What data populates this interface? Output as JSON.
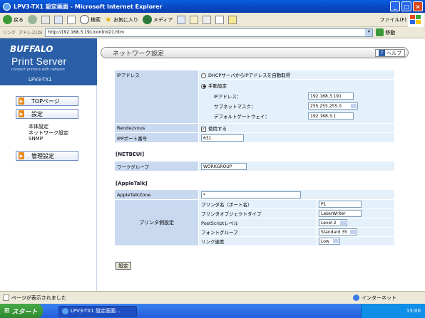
{
  "window": {
    "title": "LPV3-TX1 設定画面 - Microsoft Internet Explorer"
  },
  "toolbar": {
    "back": "戻る",
    "search": "検索",
    "favorites": "お気に入り",
    "media": "メディア",
    "file_menu": "ファイル(F)"
  },
  "address": {
    "link_label": "リンク",
    "label": "アドレス(D)",
    "url": "http://192.168.3.191/control21.htm",
    "go": "移動"
  },
  "sidebar": {
    "logo": "BUFFALO",
    "product": "Print Server",
    "tagline": "connect printers with network",
    "model": "LPV3-TX1",
    "nav": [
      {
        "label": "TOPページ"
      },
      {
        "label": "設定"
      },
      {
        "label": "管理設定"
      }
    ],
    "sub": [
      "本体設定",
      "ネットワーク設定",
      "SNMP"
    ]
  },
  "main": {
    "title": "ネットワーク設定",
    "help": "ヘルプ",
    "ip_label": "IPアドレス",
    "dhcp_option": "DHCPサーバからIPアドレスを自動取得",
    "manual_option": "手動設定",
    "ip_addr_label": "IPアドレス：",
    "ip_addr_value": "192.168.3.191",
    "subnet_label": "サブネットマスク：",
    "subnet_value": "255.255.255.0",
    "gateway_label": "デフォルトゲートウェイ：",
    "gateway_value": "192.168.3.1",
    "rendezvous_label": "Rendezvous",
    "rendezvous_option": "使用する",
    "ipp_label": "IPPポート番号",
    "ipp_value": "631",
    "netbeui_title": "[NETBEUI]",
    "workgroup_label": "ワークグループ",
    "workgroup_value": "WORKGROUP",
    "appletalk_title": "[AppleTalk]",
    "zone_label": "AppleTalkZone",
    "zone_value": "*",
    "printer_settings_label": "プリンタ側設定",
    "printer_name_label": "プリンタ名（ポート名）",
    "printer_name_value": "P1",
    "printer_type_label": "プリンタオブジェクトタイプ",
    "printer_type_value": "LaserWriter",
    "ps_level_label": "PostScriptレベル",
    "ps_level_value": "Level 2",
    "font_group_label": "フォントグループ",
    "font_group_value": "Standard 35",
    "link_speed_label": "リンク速度",
    "link_speed_value": "Low",
    "submit": "設定"
  },
  "status": {
    "text": "ページが表示されました",
    "zone": "インターネット"
  },
  "taskbar": {
    "start": "スタート",
    "task": "LPV3-TX1 設定画面...",
    "clock": "13:00"
  }
}
